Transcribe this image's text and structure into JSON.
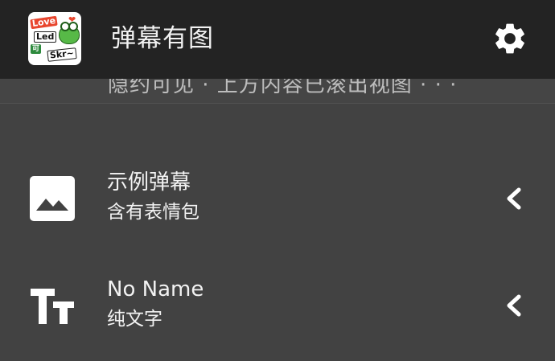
{
  "app_bar": {
    "title": "弹幕有图",
    "logo_words": [
      "Love",
      "Led",
      "可",
      "Skr~"
    ],
    "settings_icon": "gear-icon"
  },
  "scrolled_remnant": {
    "text": "隐约可见 · 上方内容已滚出视图 · · ·"
  },
  "list": {
    "items": [
      {
        "title": "示例弹幕",
        "subtitle": "含有表情包",
        "icon": "image-icon",
        "action_icon": "chevron-left-icon"
      },
      {
        "title": "No Name",
        "subtitle": "纯文字",
        "icon": "text-format-icon",
        "action_icon": "chevron-left-icon"
      }
    ]
  },
  "colors": {
    "app_bar_bg": "#232323",
    "list_bg": "#424242",
    "text_primary": "#f2f2f2",
    "icon_white": "#ffffff"
  }
}
